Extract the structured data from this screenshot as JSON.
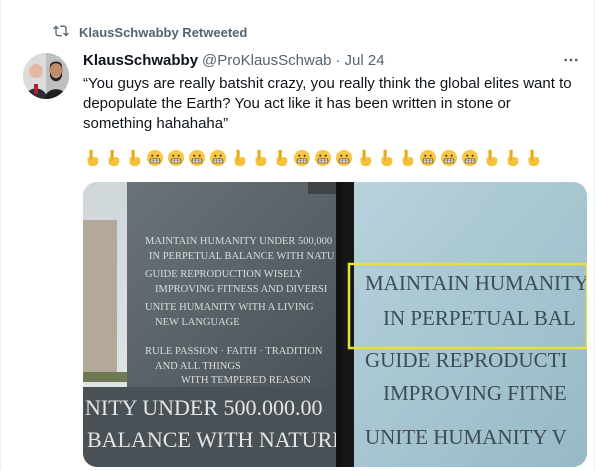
{
  "retweet": {
    "label": "KlausSchwabby Retweeted",
    "icon": "retweet-icon"
  },
  "tweet": {
    "display_name": "KlausSchwabby",
    "handle": "@ProKlausSchwab",
    "separator": "·",
    "time": "Jul 24",
    "text": "“You guys are really batshit crazy, you really think the global elites want to depopulate the Earth?  You act like it has been written in stone or something hahahaha”",
    "more_icon": "more-icon",
    "emojis": [
      "point-down",
      "point-down",
      "point-down",
      "grimace",
      "grimace",
      "grimace",
      "grimace",
      "point-down",
      "point-down",
      "point-down",
      "grimace",
      "grimace",
      "grimace",
      "point-down",
      "point-down",
      "point-down",
      "grimace",
      "grimace",
      "grimace",
      "point-down",
      "point-down",
      "point-down"
    ]
  },
  "media": {
    "left_text": {
      "line1": "MAINTAIN HUMANITY UNDER 500,000",
      "line2": "IN PERPETUAL BALANCE WITH NATU",
      "line3": "GUIDE REPRODUCTION WISELY",
      "line4": "IMPROVING FITNESS AND DIVERSI",
      "line5": "UNITE HUMANITY WITH A LIVING",
      "line6": "NEW LANGUAGE",
      "line7": "RULE PASSION · FAITH · TRADITION",
      "line8": "AND ALL THINGS",
      "line9": "WITH TEMPERED REASON",
      "zoom1": "NITY UNDER 500.000.00",
      "zoom2": "BALANCE WITH NATURE"
    },
    "right_text": {
      "line1": "MAINTAIN HUMANITY",
      "line2": "IN PERPETUAL BAL",
      "line3": "GUIDE REPRODUCTI",
      "line4": "IMPROVING FITNE",
      "line5": "UNITE HUMANITY V"
    },
    "colors": {
      "highlight": "#e8e135",
      "stone_left": "#5a6166",
      "stone_right": "#a9c7d2"
    }
  }
}
